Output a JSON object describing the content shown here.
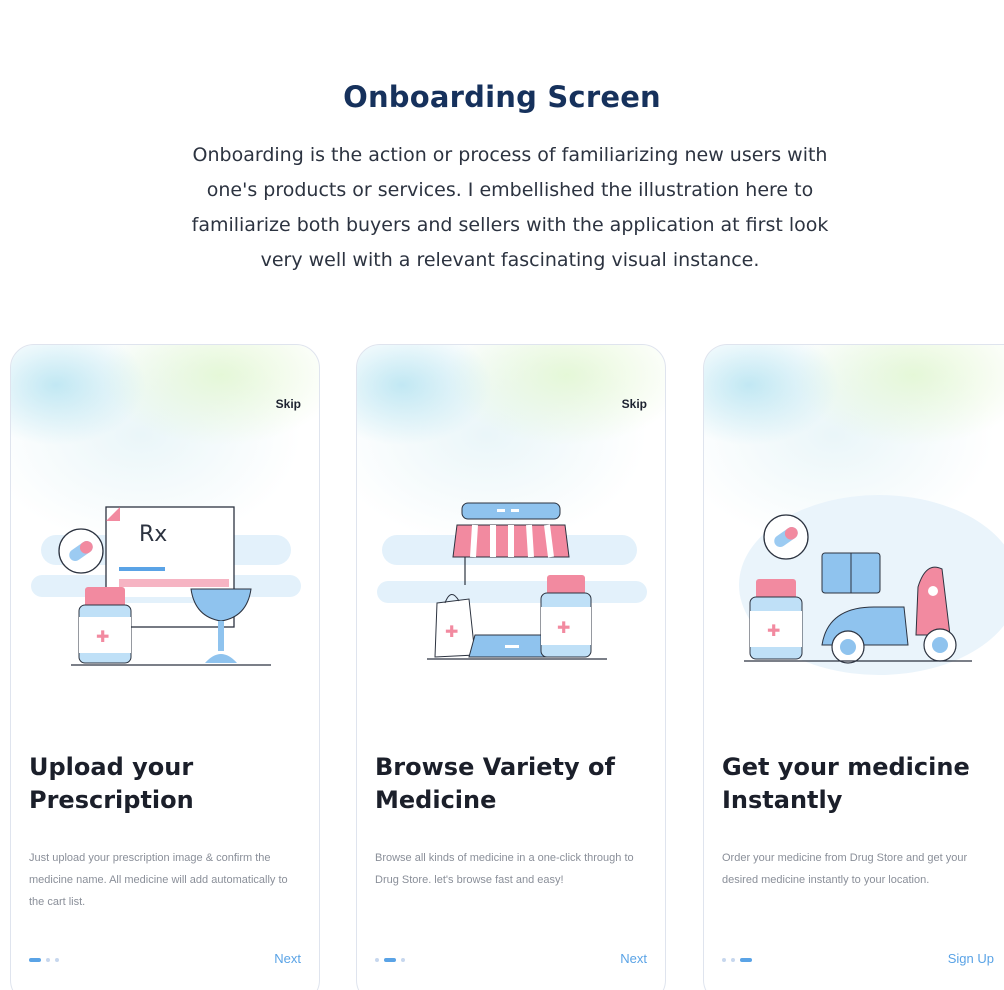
{
  "header": {
    "title": "Onboarding Screen",
    "description": "Onboarding is the action or process of familiarizing new users with one's products or services. I embellished the illustration here to familiarize both buyers and sellers with the application at first look very well with a relevant fascinating visual instance."
  },
  "screens": [
    {
      "skip": "Skip",
      "illustration_text": "Rx",
      "title": "Upload your Prescription",
      "body": "Just upload your prescription image & confirm the medicine name. All medicine will add automatically to the cart list.",
      "action": "Next",
      "active_dot": 1
    },
    {
      "skip": "Skip",
      "title": "Browse Variety of Medicine",
      "body": "Browse all kinds of medicine in a one-click through to Drug Store. let's browse fast and easy!",
      "action": "Next",
      "active_dot": 2
    },
    {
      "title": "Get your medicine Instantly",
      "body": "Order your medicine from Drug Store and get your desired medicine instantly to your location.",
      "action": "Sign Up",
      "active_dot": 3
    }
  ],
  "colors": {
    "heading": "#16315c",
    "accent": "#5aa3e6",
    "pink": "#f28aa0",
    "light_blue": "#9ccbf2"
  }
}
